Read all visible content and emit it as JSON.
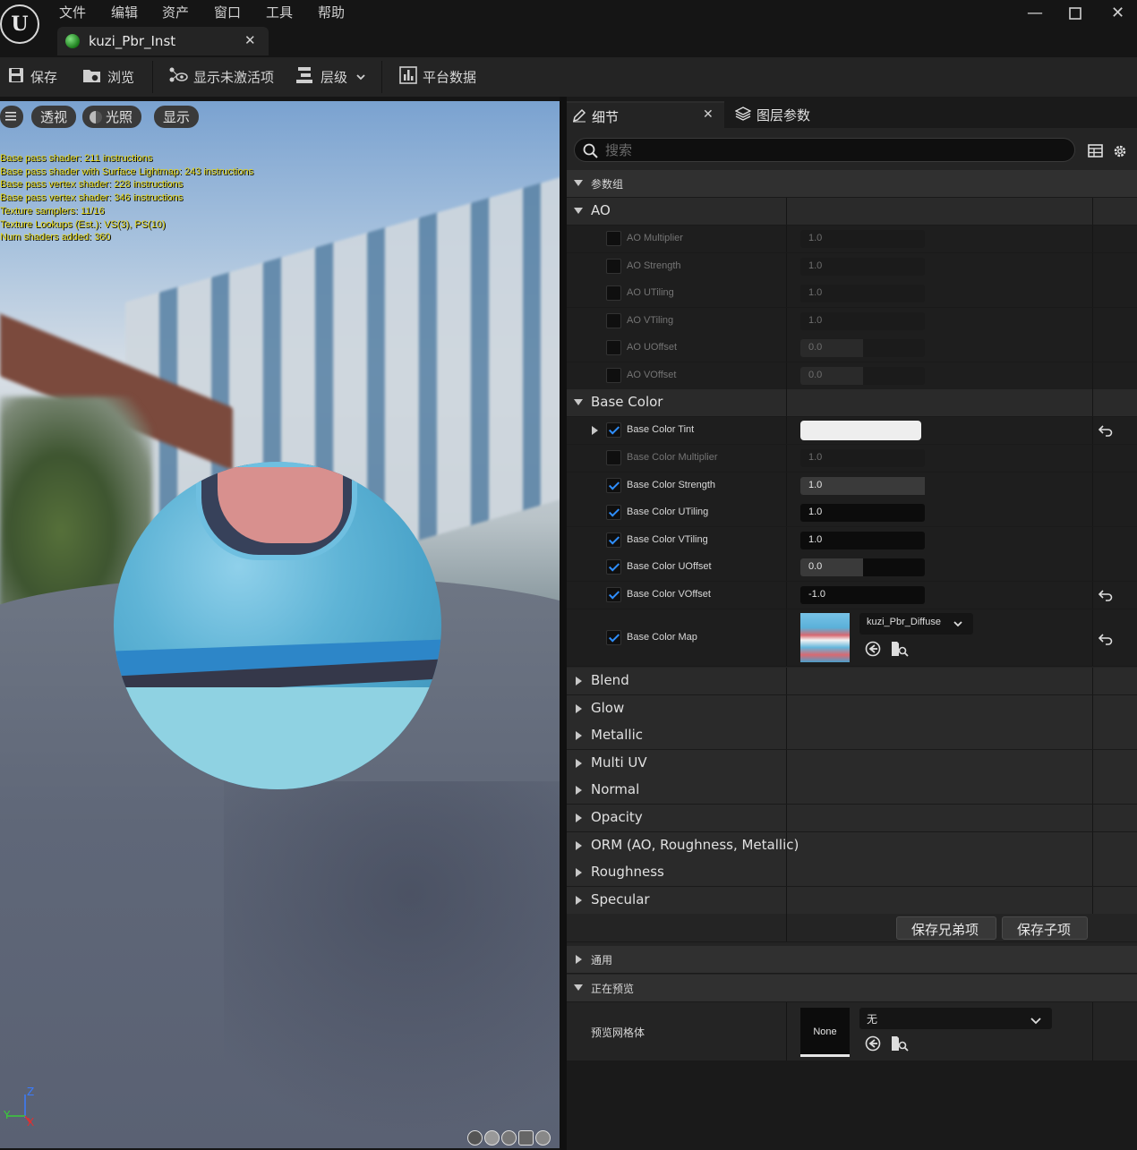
{
  "app": {
    "logo": "unreal-engine-logo",
    "menu": [
      "文件",
      "编辑",
      "资产",
      "窗口",
      "工具",
      "帮助"
    ],
    "document_tab": "kuzi_Pbr_Inst"
  },
  "toolbar": {
    "save": "保存",
    "browse": "浏览",
    "show_inactive": "显示未激活项",
    "hierarchy": "层级",
    "platform_stats": "平台数据"
  },
  "viewport": {
    "buttons": {
      "perspective": "透视",
      "lighting": "光照",
      "show": "显示"
    },
    "stats": [
      "Base pass shader: 211 instructions",
      "Base pass shader with Surface Lightmap: 243 instructions",
      "Base pass vertex shader: 228 instructions",
      "Base pass vertex shader: 346 instructions",
      "Texture samplers: 11/16",
      "Texture Lookups (Est.): VS(3), PS(10)",
      "Num shaders added: 360"
    ],
    "axis": {
      "z": "Z",
      "y": "Y",
      "x": "X"
    }
  },
  "panel": {
    "tabs": {
      "details": "细节",
      "layer_params": "图层参数"
    },
    "search_placeholder": "搜索",
    "param_groups_label": "参数组",
    "ao": {
      "label": "AO",
      "params": [
        {
          "name": "AO Multiplier",
          "value": "1.0",
          "enabled": false,
          "fill": 0
        },
        {
          "name": "AO Strength",
          "value": "1.0",
          "enabled": false,
          "fill": 0
        },
        {
          "name": "AO UTiling",
          "value": "1.0",
          "enabled": false,
          "fill": 0
        },
        {
          "name": "AO VTiling",
          "value": "1.0",
          "enabled": false,
          "fill": 0
        },
        {
          "name": "AO UOffset",
          "value": "0.0",
          "enabled": false,
          "fill": 0.5
        },
        {
          "name": "AO VOffset",
          "value": "0.0",
          "enabled": false,
          "fill": 0.5
        }
      ]
    },
    "base_color": {
      "label": "Base Color",
      "tint_label": "Base Color Tint",
      "tint_color": "#eeeeee",
      "params": [
        {
          "name": "Base Color Multiplier",
          "value": "1.0",
          "enabled": false,
          "fill": 0
        },
        {
          "name": "Base Color Strength",
          "value": "1.0",
          "enabled": true,
          "fill": 1.0
        },
        {
          "name": "Base Color UTiling",
          "value": "1.0",
          "enabled": true,
          "fill": 0
        },
        {
          "name": "Base Color VTiling",
          "value": "1.0",
          "enabled": true,
          "fill": 0
        },
        {
          "name": "Base Color UOffset",
          "value": "0.0",
          "enabled": true,
          "fill": 0.5
        },
        {
          "name": "Base Color VOffset",
          "value": "-1.0",
          "enabled": true,
          "fill": 0
        }
      ],
      "map_label": "Base Color Map",
      "map_asset": "kuzi_Pbr_Diffuse"
    },
    "collapsed_groups": [
      "Blend",
      "Glow",
      "Metallic",
      "Multi UV",
      "Normal",
      "Opacity",
      "ORM (AO, Roughness, Metallic)",
      "Roughness",
      "Specular"
    ],
    "buttons": {
      "save_sibling": "保存兄弟项",
      "save_child": "保存子项"
    },
    "general_label": "通用",
    "previewing_label": "正在预览",
    "preview_mesh_label": "预览网格体",
    "preview_mesh_thumb": "None",
    "preview_mesh_value": "无"
  },
  "colors": {
    "accent_check": "#2f8fff",
    "stats_text": "#e3d516"
  }
}
